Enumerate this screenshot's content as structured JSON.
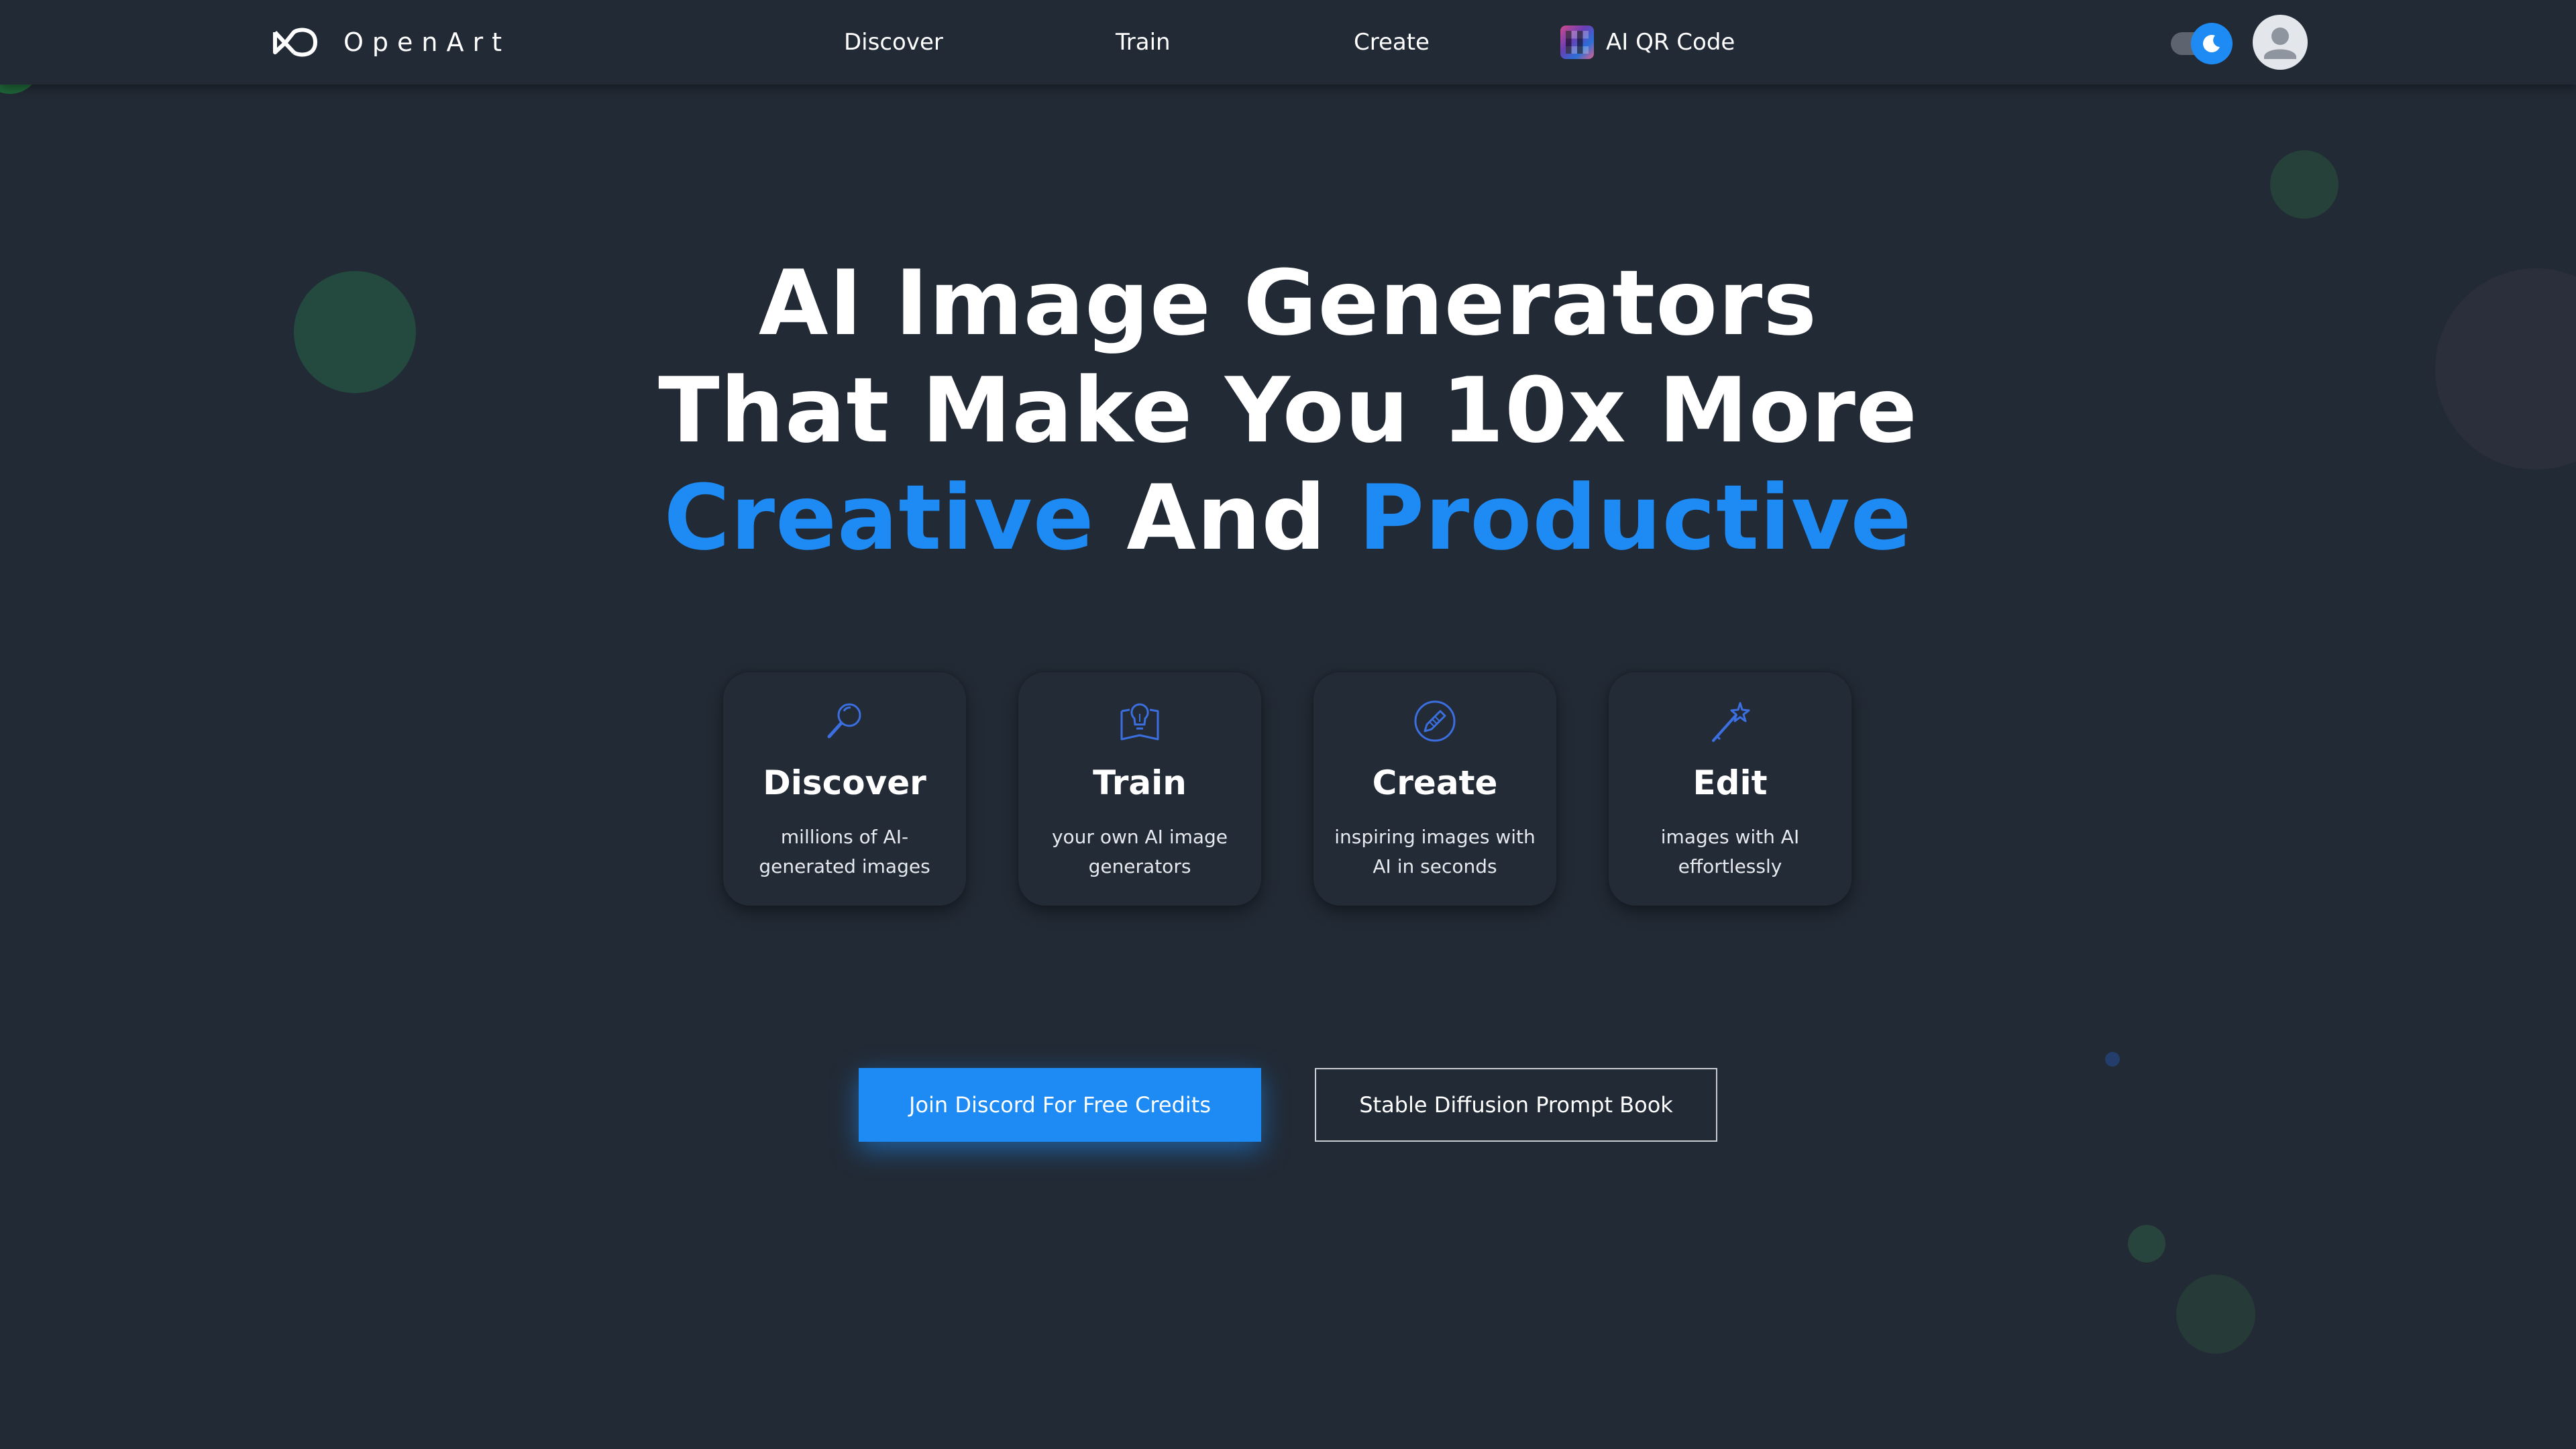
{
  "nav": {
    "brand": "OpenArt",
    "links": [
      {
        "label": "Discover"
      },
      {
        "label": "Train"
      },
      {
        "label": "Create"
      },
      {
        "label": "AI QR Code"
      }
    ],
    "theme": "dark"
  },
  "hero": {
    "line1": "AI Image Generators",
    "line2": "That Make You 10x More",
    "line3_word1": "Creative",
    "line3_word2": "And",
    "line3_word3": "Productive"
  },
  "features": [
    {
      "title": "Discover",
      "desc": "millions of AI-generated images",
      "icon": "magnifier-icon"
    },
    {
      "title": "Train",
      "desc": "your own AI image generators",
      "icon": "lightbulb-book-icon"
    },
    {
      "title": "Create",
      "desc": "inspiring images with AI in seconds",
      "icon": "pencil-circle-icon"
    },
    {
      "title": "Edit",
      "desc": "images with AI effortlessly",
      "icon": "magic-wand-icon"
    }
  ],
  "cta": {
    "primary": "Join Discord For Free Credits",
    "secondary": "Stable Diffusion Prompt Book"
  },
  "colors": {
    "background": "#222a35",
    "accent": "#1e8bf5",
    "icon_blue": "#3b6fe0"
  }
}
